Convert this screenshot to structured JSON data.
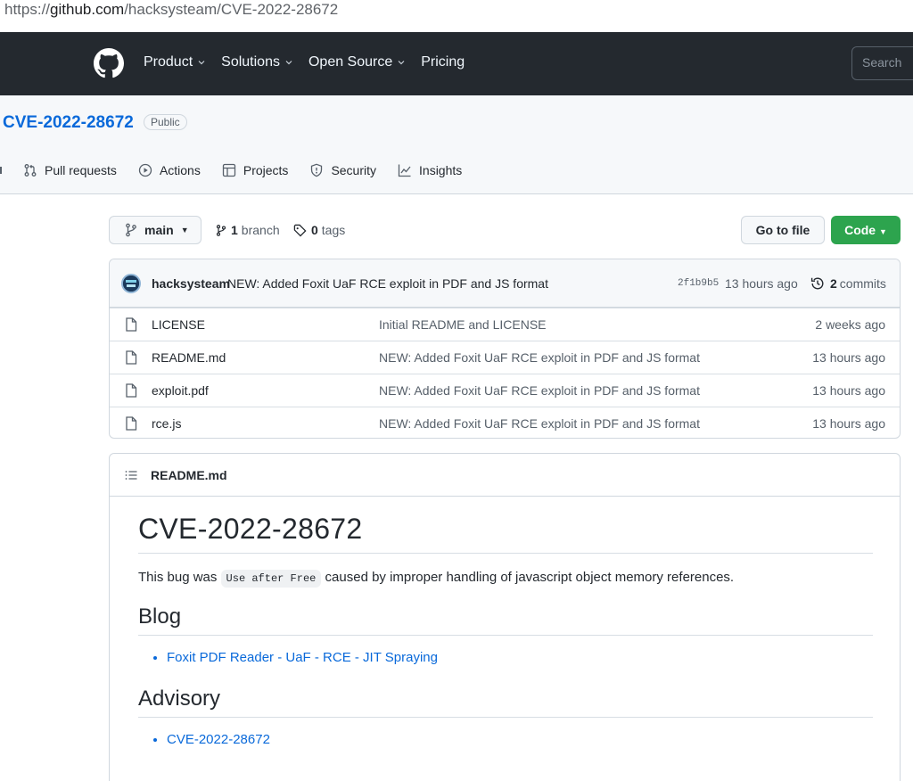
{
  "browser": {
    "url_prefix": "https://",
    "url_host": "github.com",
    "url_path": "/hacksysteam/CVE-2022-28672"
  },
  "header": {
    "nav": [
      {
        "label": "Product",
        "dropdown": true
      },
      {
        "label": "Solutions",
        "dropdown": true
      },
      {
        "label": "Open Source",
        "dropdown": true
      },
      {
        "label": "Pricing",
        "dropdown": false
      }
    ],
    "search_placeholder": "Search"
  },
  "repo": {
    "name": "CVE-2022-28672",
    "visibility": "Public",
    "tabs": [
      {
        "label": "Pull requests",
        "icon": "pull-request-icon"
      },
      {
        "label": "Actions",
        "icon": "play-icon"
      },
      {
        "label": "Projects",
        "icon": "table-icon"
      },
      {
        "label": "Security",
        "icon": "shield-icon"
      },
      {
        "label": "Insights",
        "icon": "graph-icon"
      }
    ]
  },
  "toolbar": {
    "branch": "main",
    "branch_count": "1",
    "branch_label": "branch",
    "tag_count": "0",
    "tag_label": "tags",
    "goto_file": "Go to file",
    "code": "Code"
  },
  "latest_commit": {
    "author": "hacksysteam",
    "message": "NEW: Added Foxit UaF RCE exploit in PDF and JS format",
    "sha": "2f1b9b5",
    "when": "13 hours ago",
    "commit_count": "2",
    "commit_label": "commits"
  },
  "files": [
    {
      "name": "LICENSE",
      "message": "Initial README and LICENSE",
      "age": "2 weeks ago"
    },
    {
      "name": "README.md",
      "message": "NEW: Added Foxit UaF RCE exploit in PDF and JS format",
      "age": "13 hours ago"
    },
    {
      "name": "exploit.pdf",
      "message": "NEW: Added Foxit UaF RCE exploit in PDF and JS format",
      "age": "13 hours ago"
    },
    {
      "name": "rce.js",
      "message": "NEW: Added Foxit UaF RCE exploit in PDF and JS format",
      "age": "13 hours ago"
    }
  ],
  "readme": {
    "filename": "README.md",
    "title": "CVE-2022-28672",
    "intro_before": "This bug was ",
    "intro_code": "Use after Free",
    "intro_after": " caused by improper handling of javascript object memory references.",
    "blog_heading": "Blog",
    "blog_link": "Foxit PDF Reader - UaF - RCE - JIT Spraying",
    "advisory_heading": "Advisory",
    "advisory_link": "CVE-2022-28672"
  }
}
